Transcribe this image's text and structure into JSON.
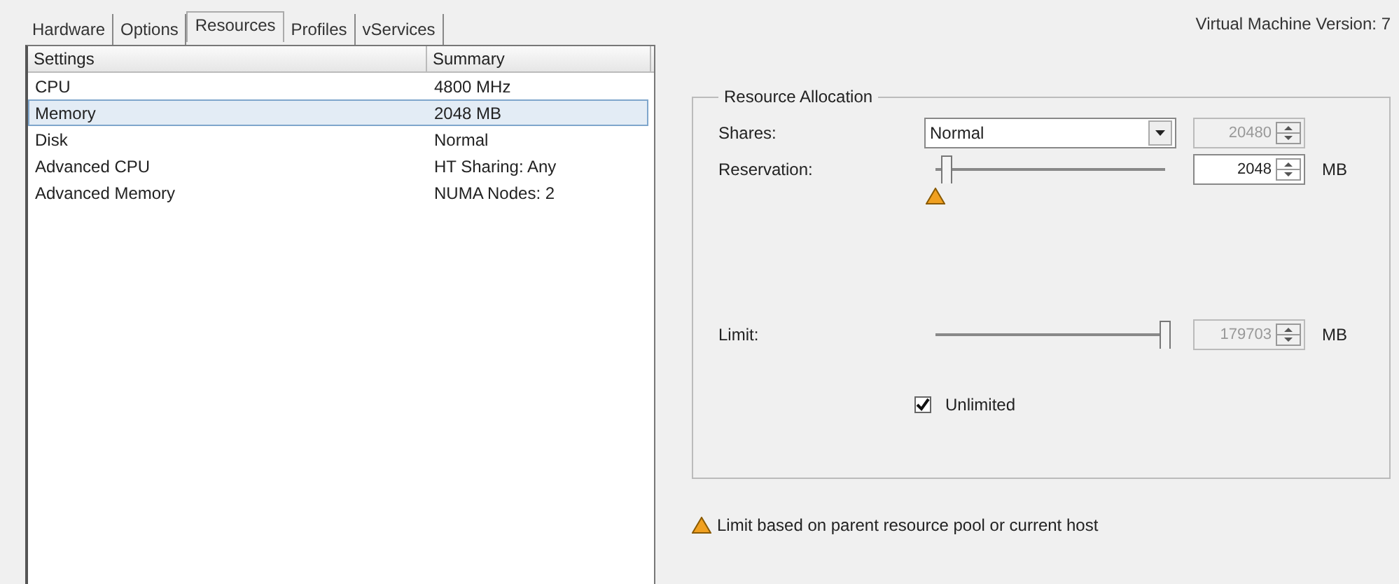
{
  "tabs": [
    {
      "label": "Hardware",
      "selected": false
    },
    {
      "label": "Options",
      "selected": false
    },
    {
      "label": "Resources",
      "selected": true
    },
    {
      "label": "Profiles",
      "selected": false
    },
    {
      "label": "vServices",
      "selected": false
    }
  ],
  "version": "Virtual Machine Version: 7",
  "table": {
    "columns": [
      "Settings",
      "Summary"
    ],
    "rows": [
      {
        "setting": "CPU",
        "summary": "4800 MHz",
        "selected": false
      },
      {
        "setting": "Memory",
        "summary": "2048 MB",
        "selected": true
      },
      {
        "setting": "Disk",
        "summary": "Normal",
        "selected": false
      },
      {
        "setting": "Advanced CPU",
        "summary": "HT Sharing: Any",
        "selected": false
      },
      {
        "setting": "Advanced Memory",
        "summary": "NUMA Nodes: 2",
        "selected": false
      }
    ]
  },
  "resource_allocation": {
    "title": "Resource Allocation",
    "shares": {
      "label": "Shares:",
      "value": "Normal",
      "spin_value": "20480",
      "spin_disabled": true
    },
    "reservation": {
      "label": "Reservation:",
      "level": 0.05,
      "value": "2048",
      "unit": "MB",
      "disabled": false,
      "warning": true
    },
    "limit": {
      "label": "Limit:",
      "level": 1,
      "value": "179703",
      "unit": "MB",
      "disabled": true,
      "warning": false
    },
    "unlimited": {
      "label": "Unlimited",
      "checked": true
    }
  },
  "note": "Limit based on parent resource pool or current host"
}
